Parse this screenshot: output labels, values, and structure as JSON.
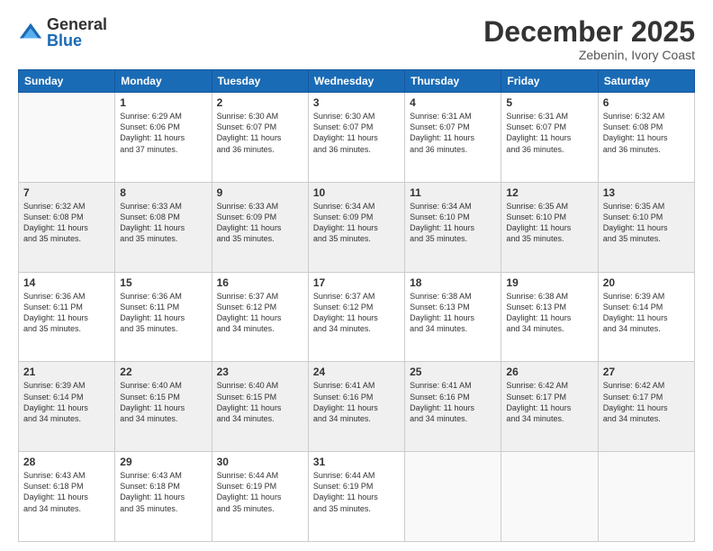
{
  "logo": {
    "general": "General",
    "blue": "Blue"
  },
  "header": {
    "month": "December 2025",
    "location": "Zebenin, Ivory Coast"
  },
  "weekdays": [
    "Sunday",
    "Monday",
    "Tuesday",
    "Wednesday",
    "Thursday",
    "Friday",
    "Saturday"
  ],
  "weeks": [
    [
      {
        "day": "",
        "empty": true
      },
      {
        "day": "1",
        "sunrise": "Sunrise: 6:29 AM",
        "sunset": "Sunset: 6:06 PM",
        "daylight": "Daylight: 11 hours and 37 minutes."
      },
      {
        "day": "2",
        "sunrise": "Sunrise: 6:30 AM",
        "sunset": "Sunset: 6:07 PM",
        "daylight": "Daylight: 11 hours and 36 minutes."
      },
      {
        "day": "3",
        "sunrise": "Sunrise: 6:30 AM",
        "sunset": "Sunset: 6:07 PM",
        "daylight": "Daylight: 11 hours and 36 minutes."
      },
      {
        "day": "4",
        "sunrise": "Sunrise: 6:31 AM",
        "sunset": "Sunset: 6:07 PM",
        "daylight": "Daylight: 11 hours and 36 minutes."
      },
      {
        "day": "5",
        "sunrise": "Sunrise: 6:31 AM",
        "sunset": "Sunset: 6:07 PM",
        "daylight": "Daylight: 11 hours and 36 minutes."
      },
      {
        "day": "6",
        "sunrise": "Sunrise: 6:32 AM",
        "sunset": "Sunset: 6:08 PM",
        "daylight": "Daylight: 11 hours and 36 minutes."
      }
    ],
    [
      {
        "day": "7",
        "sunrise": "Sunrise: 6:32 AM",
        "sunset": "Sunset: 6:08 PM",
        "daylight": "Daylight: 11 hours and 35 minutes."
      },
      {
        "day": "8",
        "sunrise": "Sunrise: 6:33 AM",
        "sunset": "Sunset: 6:08 PM",
        "daylight": "Daylight: 11 hours and 35 minutes."
      },
      {
        "day": "9",
        "sunrise": "Sunrise: 6:33 AM",
        "sunset": "Sunset: 6:09 PM",
        "daylight": "Daylight: 11 hours and 35 minutes."
      },
      {
        "day": "10",
        "sunrise": "Sunrise: 6:34 AM",
        "sunset": "Sunset: 6:09 PM",
        "daylight": "Daylight: 11 hours and 35 minutes."
      },
      {
        "day": "11",
        "sunrise": "Sunrise: 6:34 AM",
        "sunset": "Sunset: 6:10 PM",
        "daylight": "Daylight: 11 hours and 35 minutes."
      },
      {
        "day": "12",
        "sunrise": "Sunrise: 6:35 AM",
        "sunset": "Sunset: 6:10 PM",
        "daylight": "Daylight: 11 hours and 35 minutes."
      },
      {
        "day": "13",
        "sunrise": "Sunrise: 6:35 AM",
        "sunset": "Sunset: 6:10 PM",
        "daylight": "Daylight: 11 hours and 35 minutes."
      }
    ],
    [
      {
        "day": "14",
        "sunrise": "Sunrise: 6:36 AM",
        "sunset": "Sunset: 6:11 PM",
        "daylight": "Daylight: 11 hours and 35 minutes."
      },
      {
        "day": "15",
        "sunrise": "Sunrise: 6:36 AM",
        "sunset": "Sunset: 6:11 PM",
        "daylight": "Daylight: 11 hours and 35 minutes."
      },
      {
        "day": "16",
        "sunrise": "Sunrise: 6:37 AM",
        "sunset": "Sunset: 6:12 PM",
        "daylight": "Daylight: 11 hours and 34 minutes."
      },
      {
        "day": "17",
        "sunrise": "Sunrise: 6:37 AM",
        "sunset": "Sunset: 6:12 PM",
        "daylight": "Daylight: 11 hours and 34 minutes."
      },
      {
        "day": "18",
        "sunrise": "Sunrise: 6:38 AM",
        "sunset": "Sunset: 6:13 PM",
        "daylight": "Daylight: 11 hours and 34 minutes."
      },
      {
        "day": "19",
        "sunrise": "Sunrise: 6:38 AM",
        "sunset": "Sunset: 6:13 PM",
        "daylight": "Daylight: 11 hours and 34 minutes."
      },
      {
        "day": "20",
        "sunrise": "Sunrise: 6:39 AM",
        "sunset": "Sunset: 6:14 PM",
        "daylight": "Daylight: 11 hours and 34 minutes."
      }
    ],
    [
      {
        "day": "21",
        "sunrise": "Sunrise: 6:39 AM",
        "sunset": "Sunset: 6:14 PM",
        "daylight": "Daylight: 11 hours and 34 minutes."
      },
      {
        "day": "22",
        "sunrise": "Sunrise: 6:40 AM",
        "sunset": "Sunset: 6:15 PM",
        "daylight": "Daylight: 11 hours and 34 minutes."
      },
      {
        "day": "23",
        "sunrise": "Sunrise: 6:40 AM",
        "sunset": "Sunset: 6:15 PM",
        "daylight": "Daylight: 11 hours and 34 minutes."
      },
      {
        "day": "24",
        "sunrise": "Sunrise: 6:41 AM",
        "sunset": "Sunset: 6:16 PM",
        "daylight": "Daylight: 11 hours and 34 minutes."
      },
      {
        "day": "25",
        "sunrise": "Sunrise: 6:41 AM",
        "sunset": "Sunset: 6:16 PM",
        "daylight": "Daylight: 11 hours and 34 minutes."
      },
      {
        "day": "26",
        "sunrise": "Sunrise: 6:42 AM",
        "sunset": "Sunset: 6:17 PM",
        "daylight": "Daylight: 11 hours and 34 minutes."
      },
      {
        "day": "27",
        "sunrise": "Sunrise: 6:42 AM",
        "sunset": "Sunset: 6:17 PM",
        "daylight": "Daylight: 11 hours and 34 minutes."
      }
    ],
    [
      {
        "day": "28",
        "sunrise": "Sunrise: 6:43 AM",
        "sunset": "Sunset: 6:18 PM",
        "daylight": "Daylight: 11 hours and 34 minutes."
      },
      {
        "day": "29",
        "sunrise": "Sunrise: 6:43 AM",
        "sunset": "Sunset: 6:18 PM",
        "daylight": "Daylight: 11 hours and 35 minutes."
      },
      {
        "day": "30",
        "sunrise": "Sunrise: 6:44 AM",
        "sunset": "Sunset: 6:19 PM",
        "daylight": "Daylight: 11 hours and 35 minutes."
      },
      {
        "day": "31",
        "sunrise": "Sunrise: 6:44 AM",
        "sunset": "Sunset: 6:19 PM",
        "daylight": "Daylight: 11 hours and 35 minutes."
      },
      {
        "day": "",
        "empty": true
      },
      {
        "day": "",
        "empty": true
      },
      {
        "day": "",
        "empty": true
      }
    ]
  ]
}
